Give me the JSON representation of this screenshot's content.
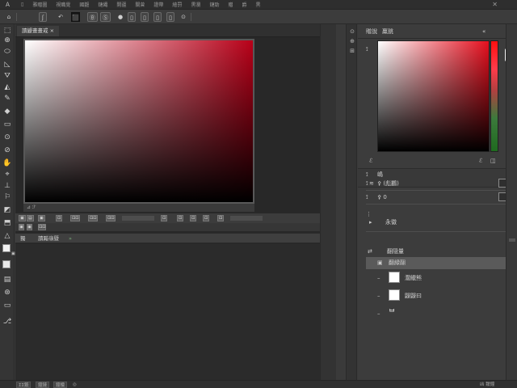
{
  "menubar": {
    "logo": "Ａ",
    "items": [
      "▯",
      "雅贈圖",
      "視職覺",
      "國鼴",
      "鏈繩",
      "開疆",
      "關曾",
      "證帶",
      "繪罸",
      "黒瀏",
      "鏈勁",
      "贈",
      "爵",
      "黒"
    ],
    "close_glyph": "✕"
  },
  "options": {
    "home_icon": "⌂",
    "labels": [
      "ʃ",
      "↶",
      "⬛",
      "Ⓑ",
      "Ⓢ",
      "●",
      "▯",
      "▯",
      "▯",
      "▯",
      "⊙"
    ]
  },
  "toolbar": {
    "tools": [
      "⬚",
      "⊕",
      "⬭",
      "◺",
      "⛛",
      "◭",
      "✎",
      "◆",
      "▭",
      "⊙",
      "⊘",
      "✋",
      "⌖",
      "⊥",
      "⚐",
      "◩",
      "⬒",
      "△",
      "▣",
      "▤",
      "⊛",
      "▭",
      "⎇"
    ]
  },
  "document": {
    "tab_label": "讀鼹畫畫戒 ×",
    "canvas_status": "⊿ ℱ",
    "anim_buttons": [
      "▣",
      "▤",
      "▣",
      "⊡",
      "⊡⊡",
      "⊡⊡",
      "⊡⊡",
      "⊡",
      "⊡",
      "⊡",
      "⊡",
      "⊡"
    ],
    "anim_row2": [
      "▣",
      "▣",
      "⊡⊡"
    ],
    "timeline": {
      "left_label": "獨",
      "title": "讀黯嶺曁",
      "icon": "»"
    }
  },
  "panels": {
    "strip_icons": [
      "⊙",
      "⊕",
      "⊞",
      "⊟",
      "⊠",
      "⊡",
      "⊢",
      "⊣",
      "⊤",
      "⊥"
    ],
    "color": {
      "header_left": "贈說",
      "header_right": "羸脁",
      "collapse_glyph": "«",
      "close_glyph": "×",
      "eyedrop_icon": "⟟",
      "footer_left": "ℰ",
      "footer_right_a": "ℰ",
      "footer_right_b": "◫"
    },
    "adjustments": {
      "header_icon": "⟟",
      "header_label": "嶋",
      "menu_glyph": "≋",
      "row1_icon": "⟟",
      "row1_label": "⚴ (彪鸝)",
      "row2_icon": "⟟",
      "row2_label": "⚴ 0",
      "row3_icon": "▸",
      "row3_label": "永徽",
      "row3_expand": "⋮"
    },
    "layers": {
      "header_icon": "⇄",
      "header_label": "翻隠量",
      "selected_icon": "▣",
      "selected_label": "翻緑翮",
      "items": [
        {
          "label": "濶鱲熊"
        },
        {
          "label": "鼹鼹曰"
        },
        {
          "label": "ᄇ"
        }
      ]
    }
  },
  "statusbar": {
    "items": [
      "ΣΣ鍛",
      "鐘鏈",
      "鐘欗",
      "◎"
    ],
    "right": "凶 靉鐘"
  }
}
